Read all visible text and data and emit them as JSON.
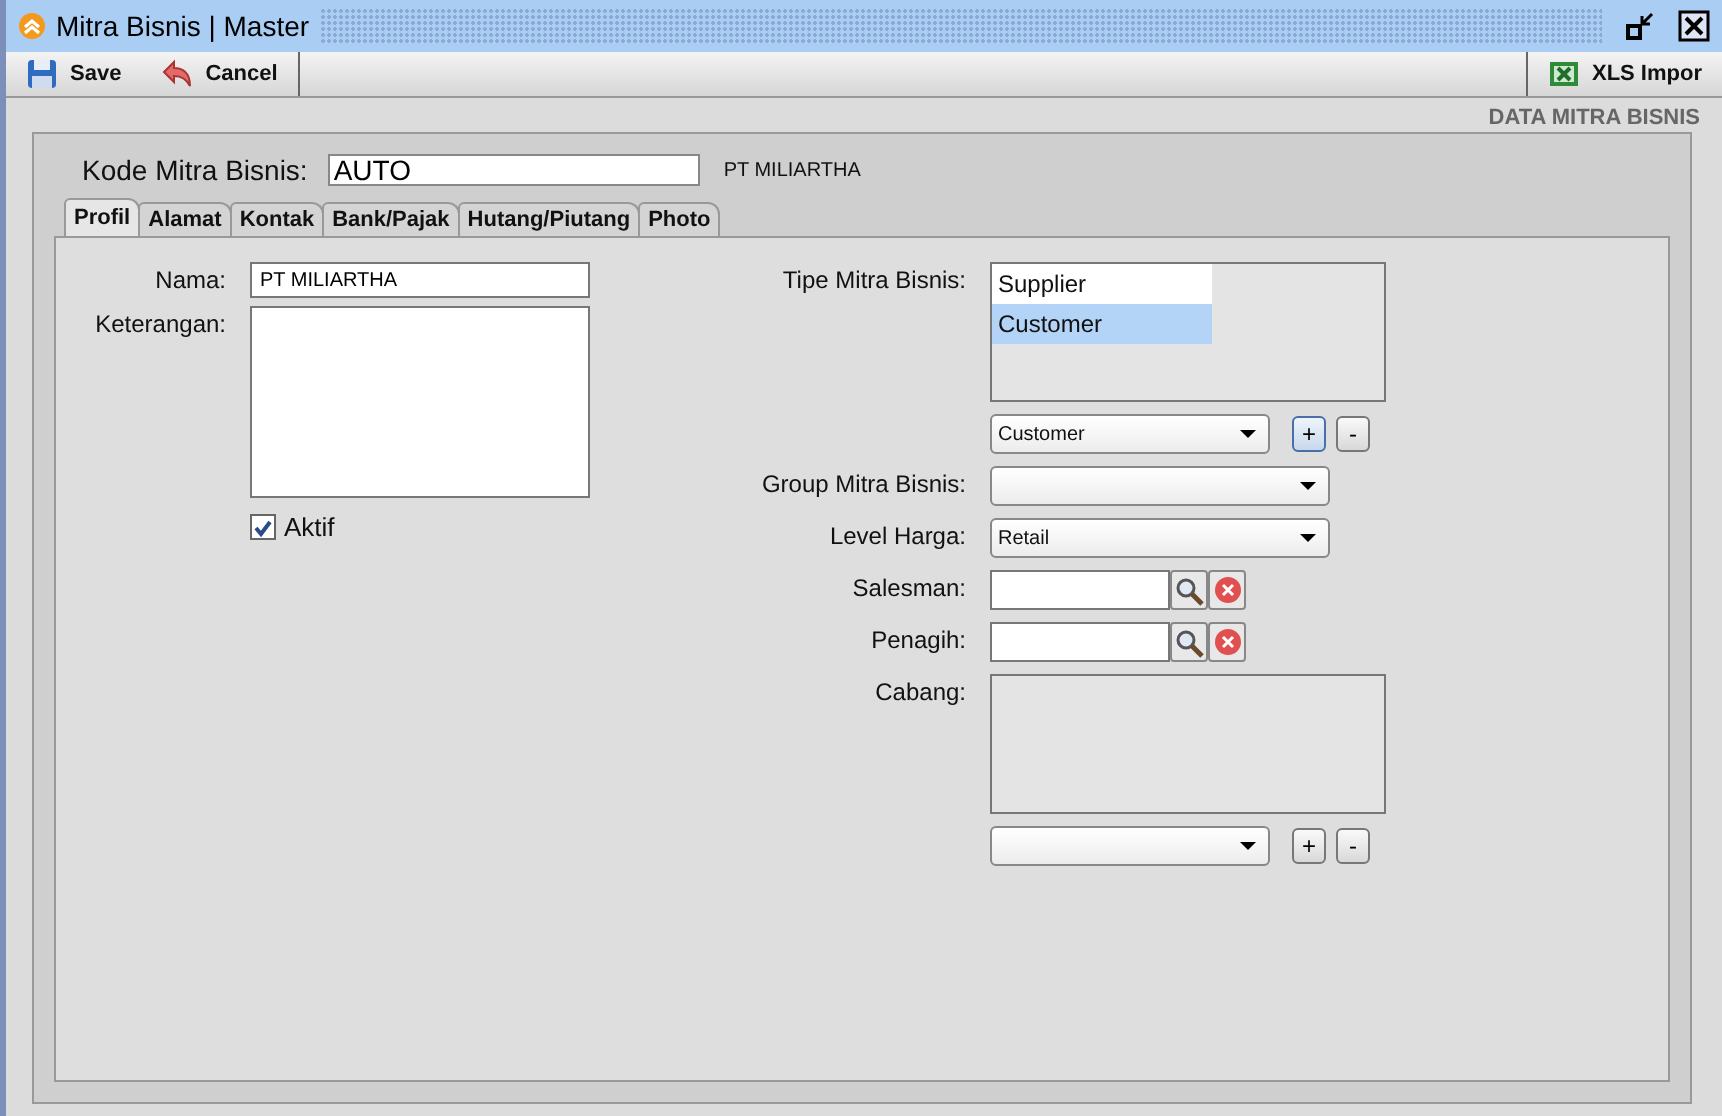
{
  "window": {
    "title": "Mitra Bisnis | Master"
  },
  "toolbar": {
    "left": [
      {
        "label": "Save",
        "kind": "save"
      },
      {
        "label": "Cancel",
        "kind": "cancel"
      }
    ],
    "right": [
      {
        "label": "XLS Impor",
        "kind": "excel"
      }
    ]
  },
  "header": "DATA MITRA BISNIS",
  "kode": {
    "label": "Kode Mitra Bisnis:",
    "value": "AUTO",
    "caption": "PT MILIARTHA"
  },
  "tabs": [
    {
      "label": "Profil",
      "selected": true
    },
    {
      "label": "Alamat",
      "selected": false
    },
    {
      "label": "Kontak",
      "selected": false
    },
    {
      "label": "Bank/Pajak",
      "selected": false
    },
    {
      "label": "Hutang/Piutang",
      "selected": false
    },
    {
      "label": "Photo",
      "selected": false
    }
  ],
  "left_fields": [
    {
      "kind": "text",
      "label": "Nama:",
      "value": "PT MILIARTHA"
    },
    {
      "kind": "textarea",
      "label": "Keterangan:"
    },
    {
      "kind": "checkbox",
      "label": "Aktif",
      "checked": true
    }
  ],
  "right_fields": [
    {
      "kind": "listbox",
      "label": "Tipe Mitra Bisnis:",
      "items": [
        {
          "label": "Supplier",
          "selected": false
        },
        {
          "label": "Customer",
          "selected": true
        }
      ]
    },
    {
      "kind": "combo_add",
      "value": "Customer",
      "buttons": [
        {
          "label": "+",
          "focused": true
        },
        {
          "label": "-",
          "focused": false
        }
      ]
    },
    {
      "kind": "combo",
      "label": "Group Mitra Bisnis:"
    },
    {
      "kind": "combo",
      "label": "Level Harga:",
      "value": "Retail"
    },
    {
      "kind": "lookup",
      "label": "Salesman:"
    },
    {
      "kind": "lookup",
      "label": "Penagih:"
    },
    {
      "kind": "listbox",
      "label": "Cabang:"
    },
    {
      "kind": "combo_add",
      "buttons": [
        {
          "label": "+",
          "focused": false
        },
        {
          "label": "-",
          "focused": false
        }
      ]
    }
  ]
}
